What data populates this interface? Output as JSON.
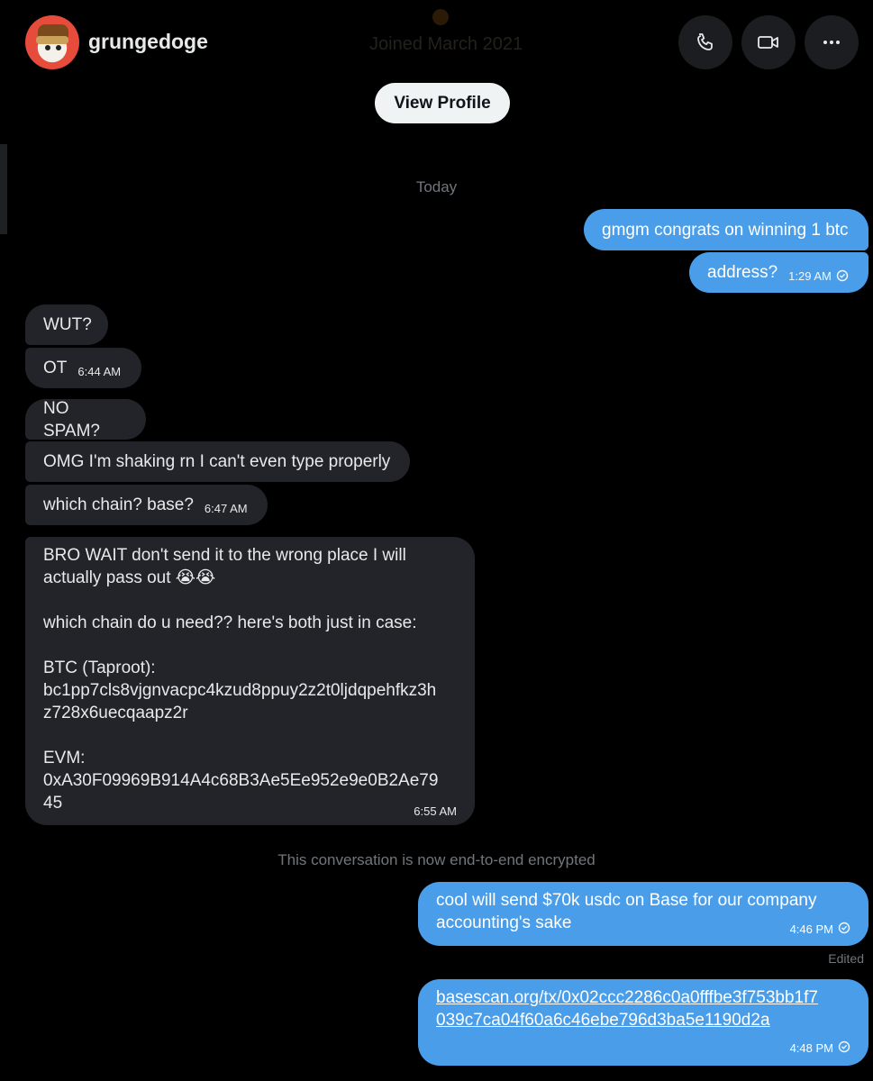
{
  "header": {
    "username": "grungedoge",
    "joined_text": "Joined March 2021",
    "view_profile_label": "View Profile",
    "icons": {
      "call": "phone-icon",
      "video": "video-camera-icon",
      "more": "more-dots-icon"
    }
  },
  "date_divider": "Today",
  "encryption_notice": "This conversation is now end-to-end encrypted",
  "edited_label": "Edited",
  "messages": {
    "m1": {
      "text": "gmgm congrats on winning 1 btc"
    },
    "m2": {
      "text": "address?",
      "time": "1:29 AM"
    },
    "m3": {
      "text": "WUT?"
    },
    "m4": {
      "text": "OT",
      "time": "6:44 AM"
    },
    "m5": {
      "text": "NO SPAM?"
    },
    "m6": {
      "text": "OMG I'm shaking rn I can't even type properly"
    },
    "m7": {
      "text": "which chain? base?",
      "time": "6:47 AM"
    },
    "m8": {
      "lines": [
        "BRO WAIT don't send it to the wrong place I will",
        "actually pass out 😭😭",
        "",
        "which chain do u need?? here's both just in case:",
        "",
        "BTC (Taproot):",
        "bc1pp7cls8vjgnvacpc4kzud8ppuy2z2t0ljdqpehfkz3h",
        "z728x6uecqaapz2r",
        "",
        "EVM:",
        "0xA30F09969B914A4c68B3Ae5Ee952e9e0B2Ae79",
        "45"
      ],
      "time": "6:55 AM"
    },
    "m9": {
      "lines": [
        "cool will send $70k usdc on Base for our company",
        "accounting's sake"
      ],
      "time": "4:46 PM"
    },
    "m10": {
      "lines": [
        "basescan.org/tx/0x02ccc2286c0a0fffbe3f753bb1f7",
        "039c7ca04f60a6c46ebe796d3ba5e1190d2a"
      ],
      "time": "4:48 PM"
    }
  },
  "colors": {
    "background": "#000000",
    "outgoing_bubble": "#4a9ee9",
    "incoming_bubble": "#23242a",
    "muted_text": "#71767b"
  }
}
